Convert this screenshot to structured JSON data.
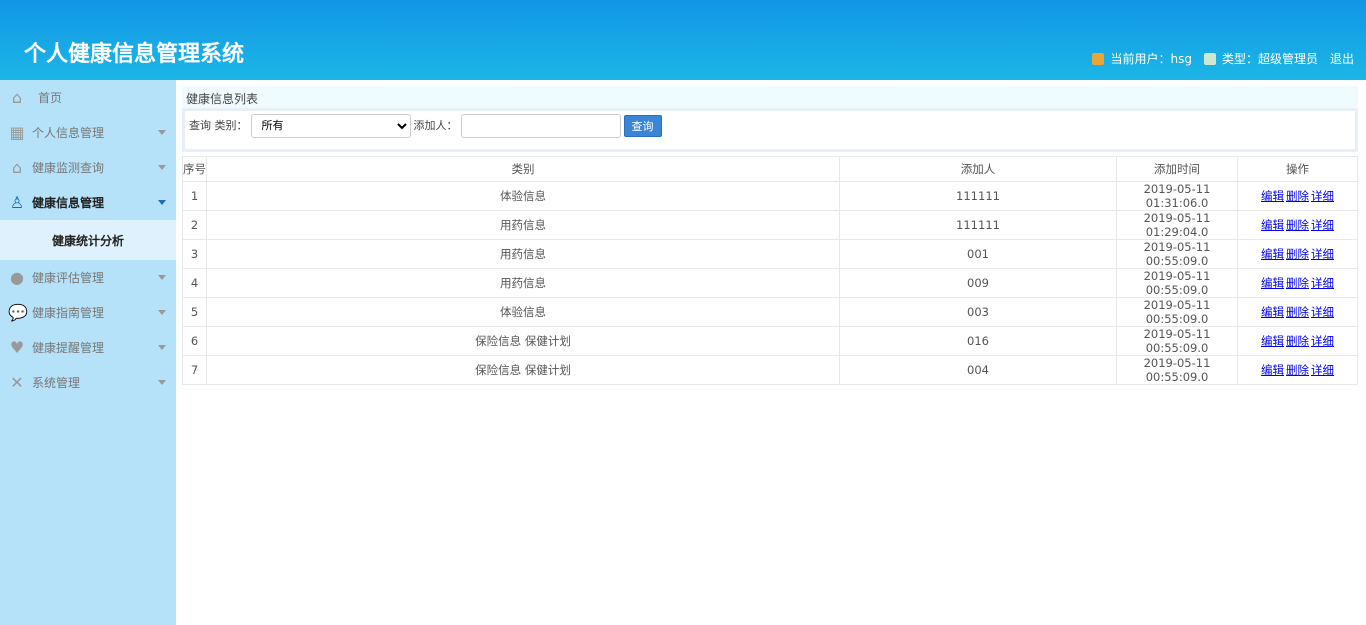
{
  "header": {
    "title": "个人健康信息管理系统",
    "current_user": "当前用户：hsg",
    "user_type": "类型：超级管理员",
    "logout": "退出"
  },
  "sidebar": {
    "items": [
      {
        "label": "首页",
        "icon": "home-icon"
      },
      {
        "label": "个人信息管理",
        "icon": "grid-icon"
      },
      {
        "label": "健康监测查询",
        "icon": "home-icon"
      },
      {
        "label": "健康信息管理",
        "icon": "users-icon"
      },
      {
        "label": "健康评估管理",
        "icon": "user-icon"
      },
      {
        "label": "健康指南管理",
        "icon": "chat-icon"
      },
      {
        "label": "健康提醒管理",
        "icon": "heart-icon"
      },
      {
        "label": "系统管理",
        "icon": "tools-icon"
      }
    ],
    "sub_item": "健康统计分析"
  },
  "main": {
    "title": "健康信息列表",
    "search": {
      "label": "查询 类别：",
      "category": "所有",
      "adder_label": "添加人：",
      "adder_value": "",
      "button": "查询"
    },
    "columns": [
      "序号",
      "类别",
      "添加人",
      "添加时间",
      "操作"
    ],
    "actions": [
      "编辑",
      "删除",
      "详细"
    ],
    "rows": [
      [
        "1",
        "体验信息",
        "111111",
        "2019-05-11 01:31:06.0"
      ],
      [
        "2",
        "用药信息",
        "111111",
        "2019-05-11 01:29:04.0"
      ],
      [
        "3",
        "用药信息",
        "001",
        "2019-05-11 00:55:09.0"
      ],
      [
        "4",
        "用药信息",
        "009",
        "2019-05-11 00:55:09.0"
      ],
      [
        "5",
        "体验信息",
        "003",
        "2019-05-11 00:55:09.0"
      ],
      [
        "6",
        "保险信息 保健计划",
        "016",
        "2019-05-11 00:55:09.0"
      ],
      [
        "7",
        "保险信息 保健计划",
        "004",
        "2019-05-11 00:55:09.0"
      ]
    ]
  }
}
